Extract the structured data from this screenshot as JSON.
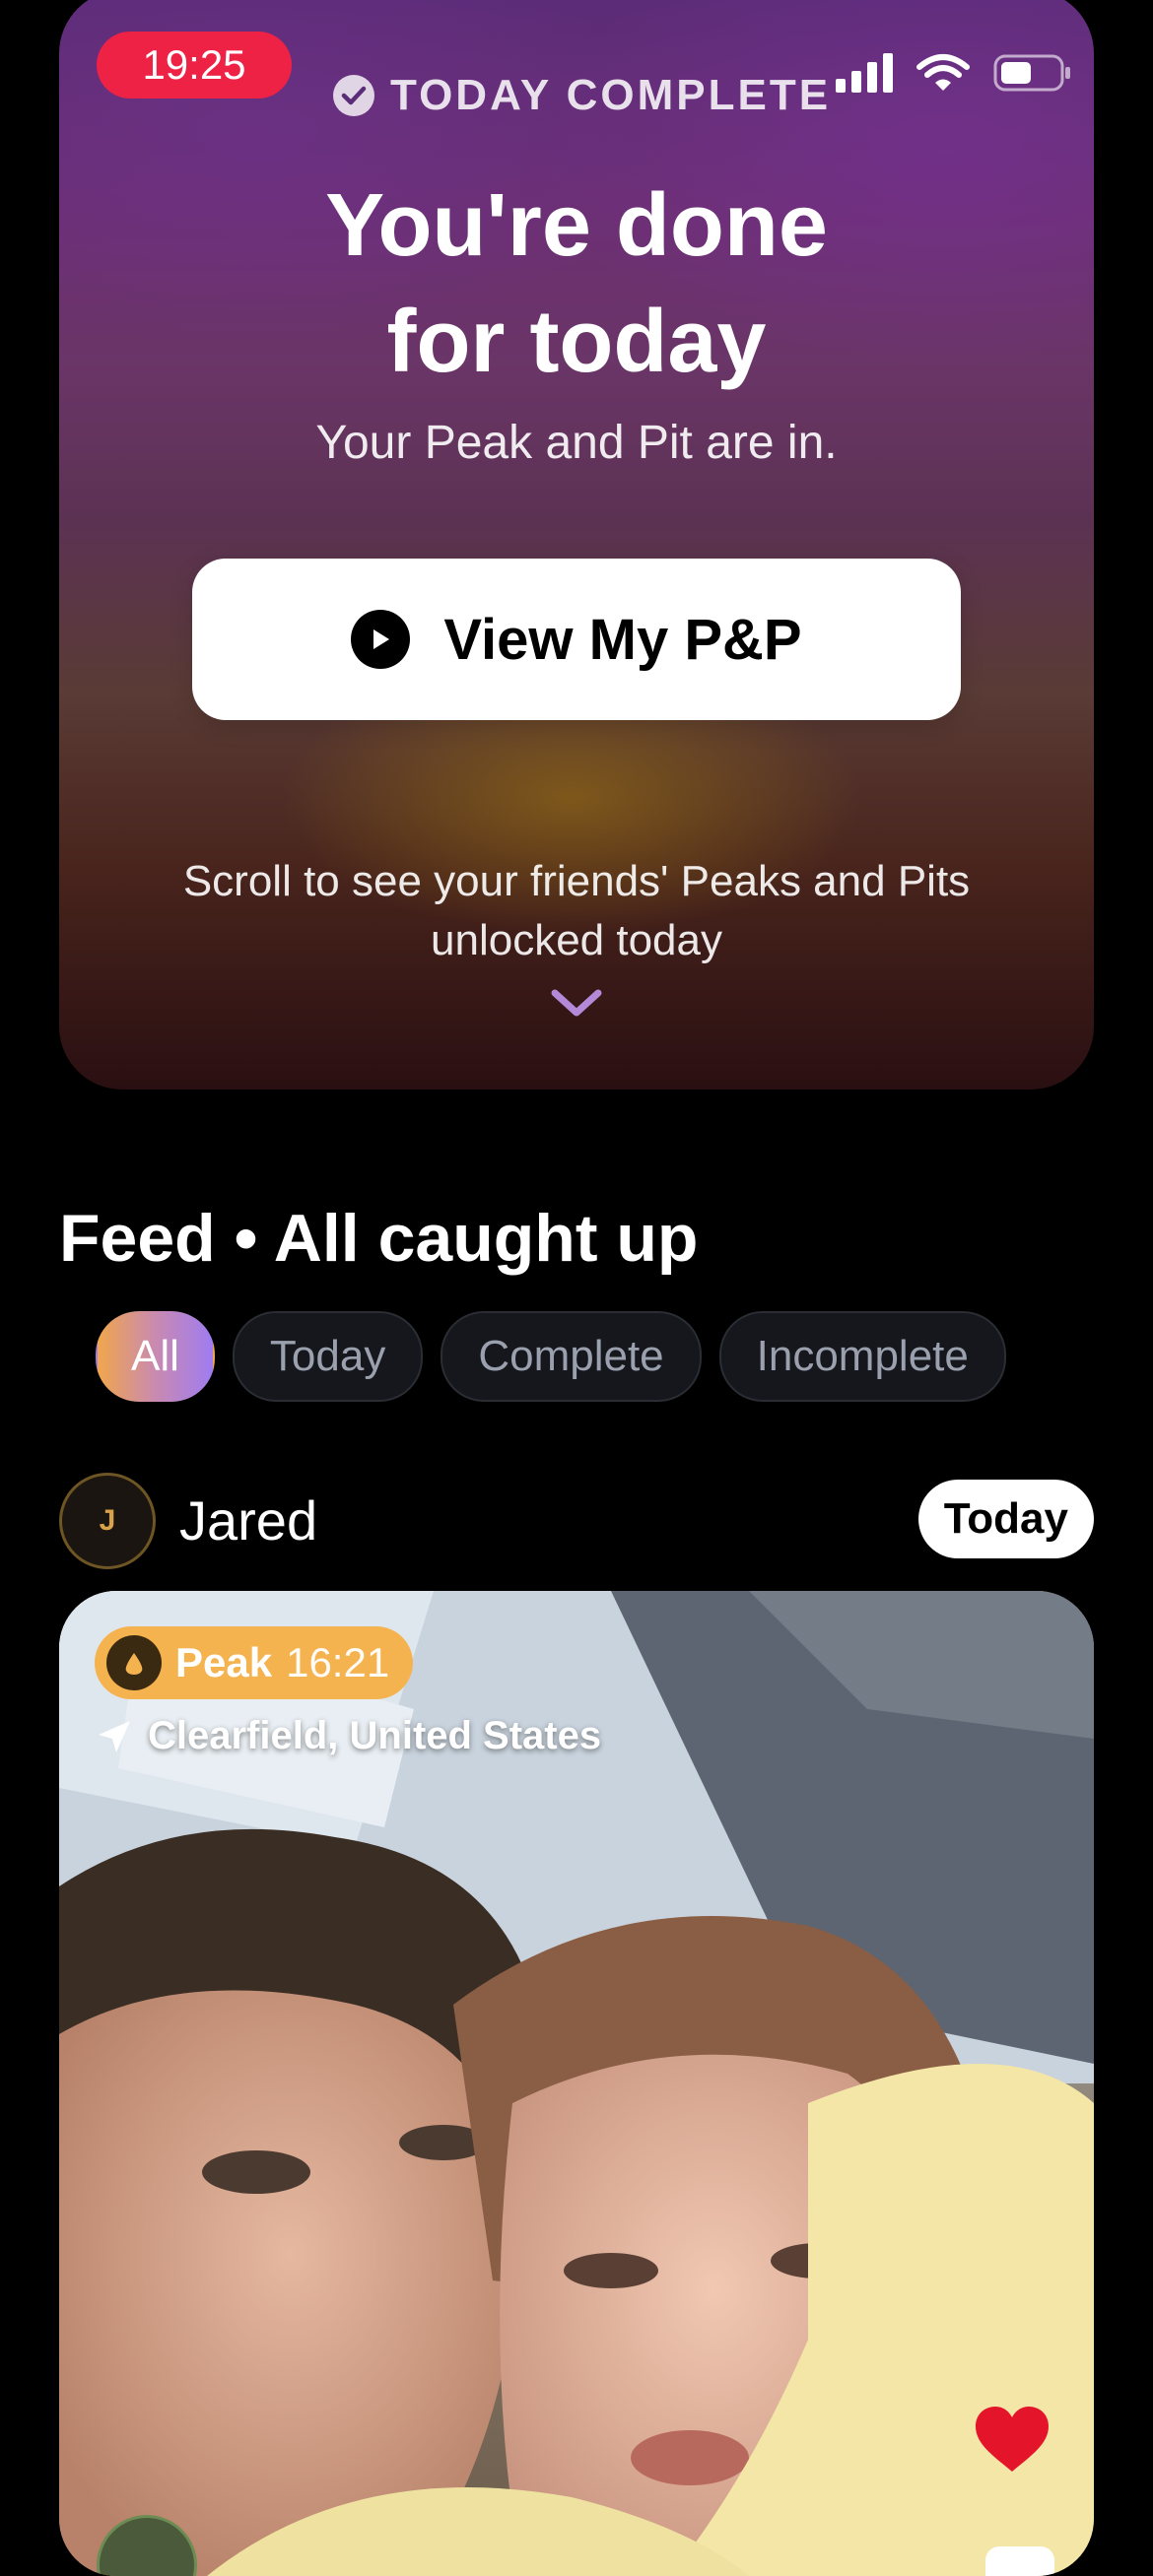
{
  "status_bar": {
    "time": "19:25"
  },
  "hero": {
    "badge": "TODAY COMPLETE",
    "title_line1": "You're done",
    "title_line2": "for today",
    "subtitle": "Your Peak and Pit are in.",
    "button_label": "View My P&P",
    "scroll_hint_line1": "Scroll to see your friends' Peaks and Pits",
    "scroll_hint_line2": "unlocked today"
  },
  "feed": {
    "title": "Feed • All caught up",
    "filters": [
      {
        "label": "All",
        "active": true
      },
      {
        "label": "Today",
        "active": false
      },
      {
        "label": "Complete",
        "active": false
      },
      {
        "label": "Incomplete",
        "active": false
      }
    ]
  },
  "post": {
    "user": {
      "initial": "J",
      "name": "Jared"
    },
    "badge": "Today",
    "type": "Peak",
    "time": "16:21",
    "location": "Clearfield, United States"
  },
  "colors": {
    "time_pill": "#ee2244",
    "peak_accent": "#f4b34f",
    "chip_gradient_start": "#f0a64c",
    "chip_gradient_end": "#9f7cf0"
  }
}
